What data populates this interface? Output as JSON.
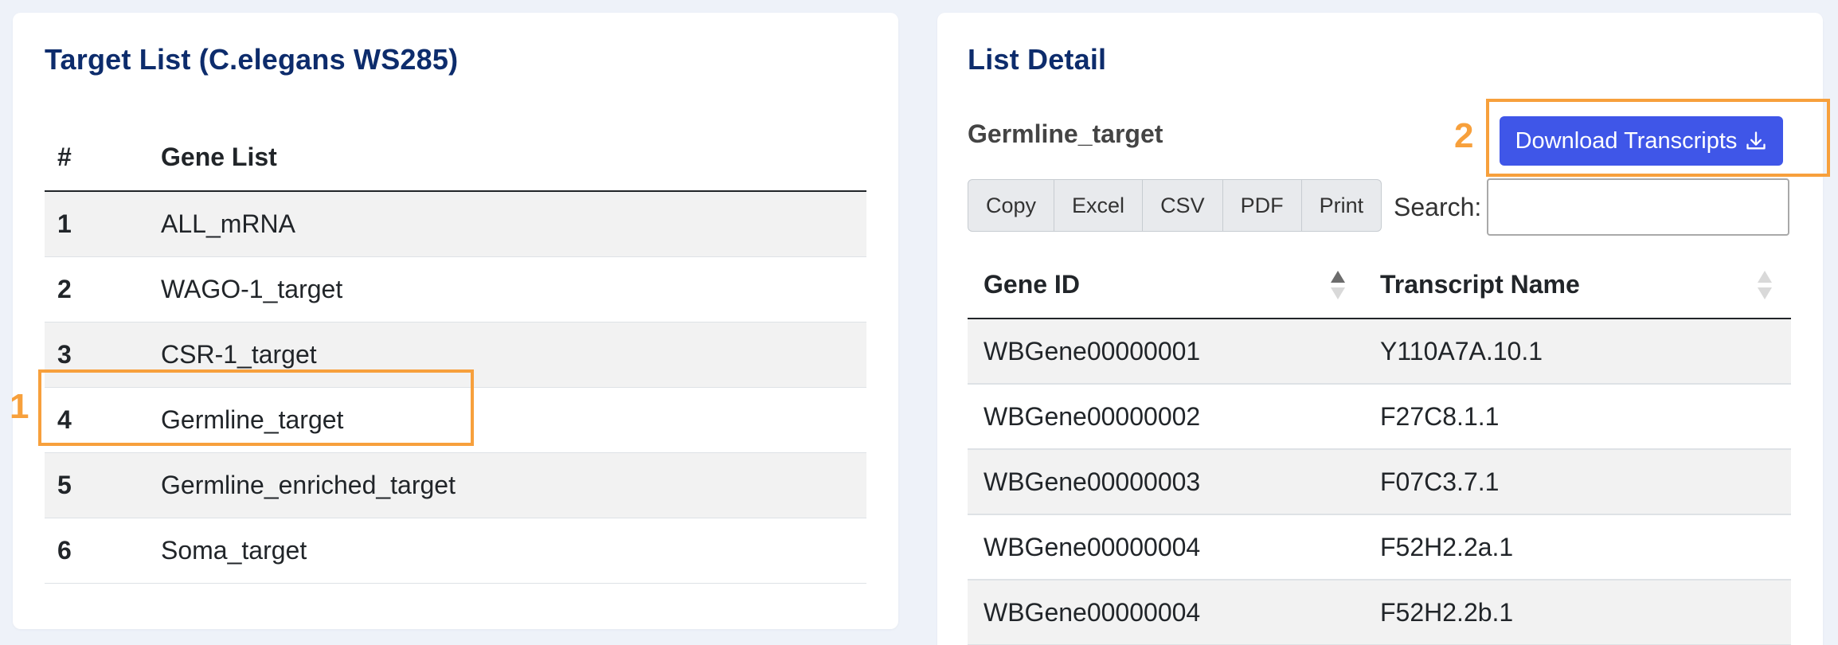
{
  "left_panel": {
    "title": "Target List (C.elegans WS285)",
    "table": {
      "headers": [
        "#",
        "Gene List"
      ],
      "rows": [
        {
          "num": "1",
          "name": "ALL_mRNA"
        },
        {
          "num": "2",
          "name": "WAGO-1_target"
        },
        {
          "num": "3",
          "name": "CSR-1_target"
        },
        {
          "num": "4",
          "name": "Germline_target"
        },
        {
          "num": "5",
          "name": "Germline_enriched_target"
        },
        {
          "num": "6",
          "name": "Soma_target"
        }
      ]
    }
  },
  "right_panel": {
    "title": "List Detail",
    "list_name": "Germline_target",
    "download_label": "Download Transcripts",
    "export_buttons": [
      "Copy",
      "Excel",
      "CSV",
      "PDF",
      "Print"
    ],
    "search_label": "Search:",
    "search_value": "",
    "table": {
      "headers": [
        "Gene ID",
        "Transcript Name"
      ],
      "rows": [
        {
          "gene_id": "WBGene00000001",
          "transcript": "Y110A7A.10.1"
        },
        {
          "gene_id": "WBGene00000002",
          "transcript": "F27C8.1.1"
        },
        {
          "gene_id": "WBGene00000003",
          "transcript": "F07C3.7.1"
        },
        {
          "gene_id": "WBGene00000004",
          "transcript": "F52H2.2a.1"
        },
        {
          "gene_id": "WBGene00000004",
          "transcript": "F52H2.2b.1"
        }
      ]
    }
  },
  "annotations": {
    "step1": "1",
    "step2": "2"
  },
  "colors": {
    "title": "#0d2c6c",
    "button": "#3f56e8",
    "annotation": "#f7a03c",
    "background": "#eef2f9"
  }
}
